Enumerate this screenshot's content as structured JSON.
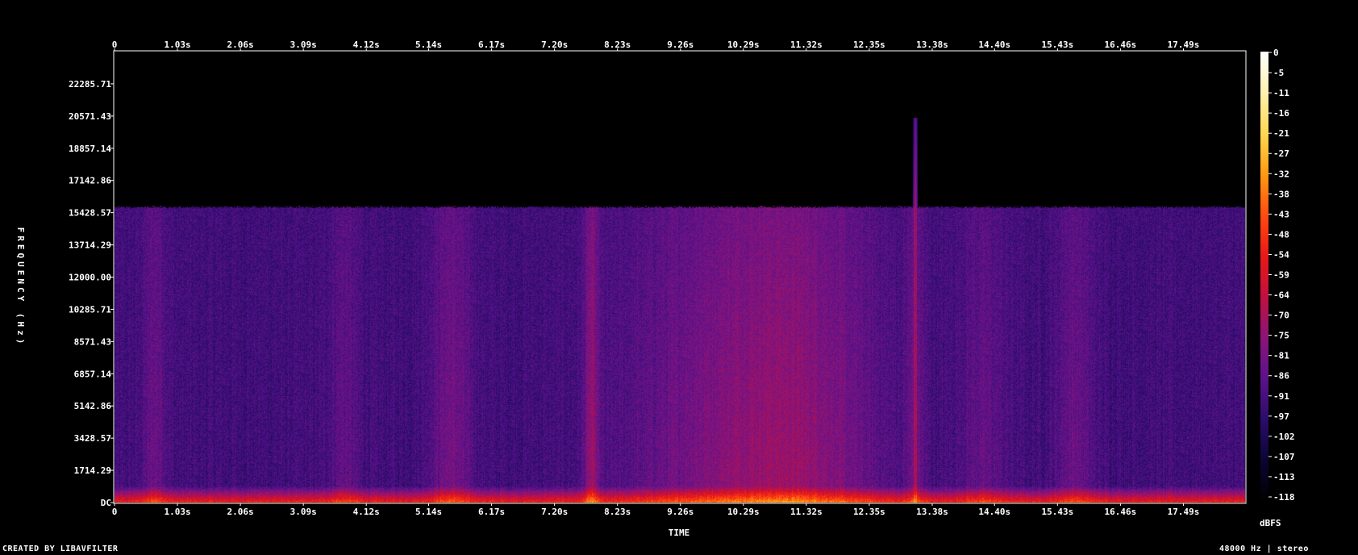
{
  "chart_data": {
    "type": "heatmap",
    "title": "",
    "xlabel": "TIME",
    "ylabel": "FREQUENCY (Hz)",
    "colorbar_label": "dBFS",
    "x_ticks": [
      "0",
      "1.03s",
      "2.06s",
      "3.09s",
      "4.12s",
      "5.14s",
      "6.17s",
      "7.20s",
      "8.23s",
      "9.26s",
      "10.29s",
      "11.32s",
      "12.35s",
      "13.38s",
      "14.40s",
      "15.43s",
      "16.46s",
      "17.49s"
    ],
    "x_tick_values": [
      0,
      1.03,
      2.06,
      3.09,
      4.12,
      5.14,
      6.17,
      7.2,
      8.23,
      9.26,
      10.29,
      11.32,
      12.35,
      13.38,
      14.4,
      15.43,
      16.46,
      17.49
    ],
    "xlim": [
      0,
      18.5
    ],
    "y_ticks": [
      "22285.71",
      "20571.43",
      "18857.14",
      "17142.86",
      "15428.57",
      "13714.29",
      "12000.00",
      "10285.71",
      "8571.43",
      "6857.14",
      "5142.86",
      "3428.57",
      "1714.29",
      "DC"
    ],
    "y_tick_values": [
      22285.71,
      20571.43,
      18857.14,
      17142.86,
      15428.57,
      13714.29,
      12000.0,
      10285.71,
      8571.43,
      6857.14,
      5142.86,
      3428.57,
      1714.29,
      0
    ],
    "ylim": [
      0,
      24000
    ],
    "colorbar_ticks": [
      "0",
      "-5",
      "-11",
      "-16",
      "-21",
      "-27",
      "-32",
      "-38",
      "-43",
      "-48",
      "-54",
      "-59",
      "-64",
      "-70",
      "-75",
      "-81",
      "-86",
      "-91",
      "-97",
      "-102",
      "-107",
      "-113",
      "-118"
    ],
    "colorbar_range": [
      -120,
      0
    ],
    "content_cutoff_hz": 15750,
    "floor_db": -93,
    "bright_bands": [
      {
        "t": 0.66,
        "width": 0.2,
        "boost": 10
      },
      {
        "t": 3.75,
        "width": 0.25,
        "boost": 8
      },
      {
        "t": 5.5,
        "width": 0.35,
        "boost": 12
      },
      {
        "t": 7.8,
        "width": 0.12,
        "boost": 18
      },
      {
        "t": 9.9,
        "width": 1.5,
        "boost": 13
      },
      {
        "t": 11.3,
        "width": 1.2,
        "boost": 14
      },
      {
        "t": 13.1,
        "width": 0.15,
        "boost": 10
      },
      {
        "t": 14.2,
        "width": 0.4,
        "boost": 8
      },
      {
        "t": 15.7,
        "width": 0.3,
        "boost": 10
      }
    ],
    "transient": {
      "t": 13.1,
      "top_hz": 20500
    }
  },
  "colors": {
    "background": "#000000",
    "frame": "#ffffff",
    "scale_stops": [
      "#000000",
      "#0a0530",
      "#2a0c6a",
      "#5a128a",
      "#8a147a",
      "#c01040",
      "#e81818",
      "#ff4a10",
      "#ff9a10",
      "#ffd850",
      "#fff0b0",
      "#ffffff"
    ]
  },
  "footer": {
    "credit": "CREATED BY LIBAVFILTER",
    "info": "48000 Hz | stereo"
  }
}
